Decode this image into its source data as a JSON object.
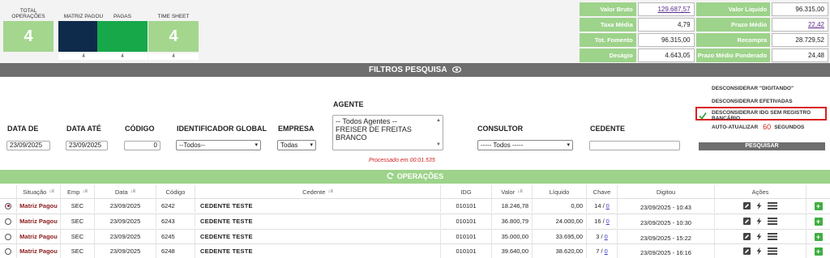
{
  "counters": [
    {
      "label": "TOTAL OPERAÇÕES",
      "value": "4",
      "sub": "",
      "color": "#a4d68e"
    },
    {
      "label": "MATRIZ PAGOU",
      "value": "",
      "sub": "4",
      "color": "#0f2b4b"
    },
    {
      "label": "PAGAS",
      "value": "",
      "sub": "4",
      "color": "#17a84a"
    },
    {
      "label": "TIME SHEET",
      "value": "4",
      "sub": "4",
      "color": "#a4d68e"
    }
  ],
  "summary": [
    {
      "label": "Valor Bruto",
      "value": "129.687,57",
      "value_link": true,
      "label2": "Valor Liquido",
      "value2": "96.315,00",
      "value2_link": false
    },
    {
      "label": "Taxa Média",
      "value": "4,79",
      "value_link": false,
      "label2": "Prazo Médio",
      "value2": "22,42",
      "value2_link": true
    },
    {
      "label": "Tot. Fomento",
      "value": "96.315,00",
      "value_link": false,
      "label2": "Recompra",
      "value2": "28.729,52",
      "value2_link": false
    },
    {
      "label": "Deságio",
      "value": "4.643,05",
      "value_link": false,
      "label2": "Prazo Médio Ponderado",
      "value2": "24,48",
      "value2_link": false
    }
  ],
  "filters": {
    "title": "FILTROS PESQUISA",
    "data_de_label": "DATA DE",
    "data_de_value": "23/09/2025",
    "data_ate_label": "DATA ATÉ",
    "data_ate_value": "23/09/2025",
    "codigo_label": "CÓDIGO",
    "codigo_value": "0",
    "identificador_label": "IDENTIFICADOR GLOBAL",
    "identificador_value": "--Todos--",
    "empresa_label": "EMPRESA",
    "empresa_value": "Todas",
    "agente_label": "AGENTE",
    "agente_options": [
      "-- Todos Agentes --",
      "FREISER DE FREITAS BRANCO"
    ],
    "consultor_label": "CONSULTOR",
    "consultor_value": "----- Todos -----",
    "cedente_label": "CEDENTE",
    "cedente_value": "",
    "processado": "Processado em 00:01.535"
  },
  "options": {
    "opt1": "DESCONSIDERAR \"DIGITANDO\"",
    "opt2": "DESCONSIDERAR EFETIVADAS",
    "opt3": "DESCONSIDERAR IDG SEM REGISTRO BANCÁRIO",
    "opt4": "AUTO-ATUALIZAR",
    "seconds": "60",
    "seconds_label": "SEGUNDOS",
    "search_button": "PESQUISAR"
  },
  "operations": {
    "title": "OPERAÇÕES",
    "columns": [
      "Situação",
      "Emp",
      "Data",
      "Código",
      "Cedente",
      "IDG",
      "Valor",
      "Líquido",
      "Chave",
      "Digitou",
      "Ações"
    ],
    "rows": [
      {
        "situacao": "Matriz Pagou",
        "emp": "SEC",
        "data": "23/09/2025",
        "codigo": "6242",
        "cedente": "CEDENTE TESTE",
        "idg": "010101",
        "valor": "18.246,78",
        "liquido": "0,00",
        "chave": "14 /",
        "chave_link": "0",
        "digitou": "23/09/2025 - 10:43",
        "selected": true
      },
      {
        "situacao": "Matriz Pagou",
        "emp": "SEC",
        "data": "23/09/2025",
        "codigo": "6243",
        "cedente": "CEDENTE TESTE",
        "idg": "010101",
        "valor": "36.800,79",
        "liquido": "24.000,00",
        "chave": "16 /",
        "chave_link": "0",
        "digitou": "23/09/2025 - 10:30",
        "selected": false
      },
      {
        "situacao": "Matriz Pagou",
        "emp": "SEC",
        "data": "23/09/2025",
        "codigo": "6245",
        "cedente": "CEDENTE TESTE",
        "idg": "010101",
        "valor": "35.000,00",
        "liquido": "33.695,00",
        "chave": "3 /",
        "chave_link": "0",
        "digitou": "23/09/2025 - 15:22",
        "selected": false
      },
      {
        "situacao": "Matriz Pagou",
        "emp": "SEC",
        "data": "23/09/2025",
        "codigo": "6248",
        "cedente": "CEDENTE TESTE",
        "idg": "010101",
        "valor": "39.640,00",
        "liquido": "38.620,00",
        "chave": "7 /",
        "chave_link": "0",
        "digitou": "23/09/2025 - 16:16",
        "selected": false
      }
    ]
  }
}
